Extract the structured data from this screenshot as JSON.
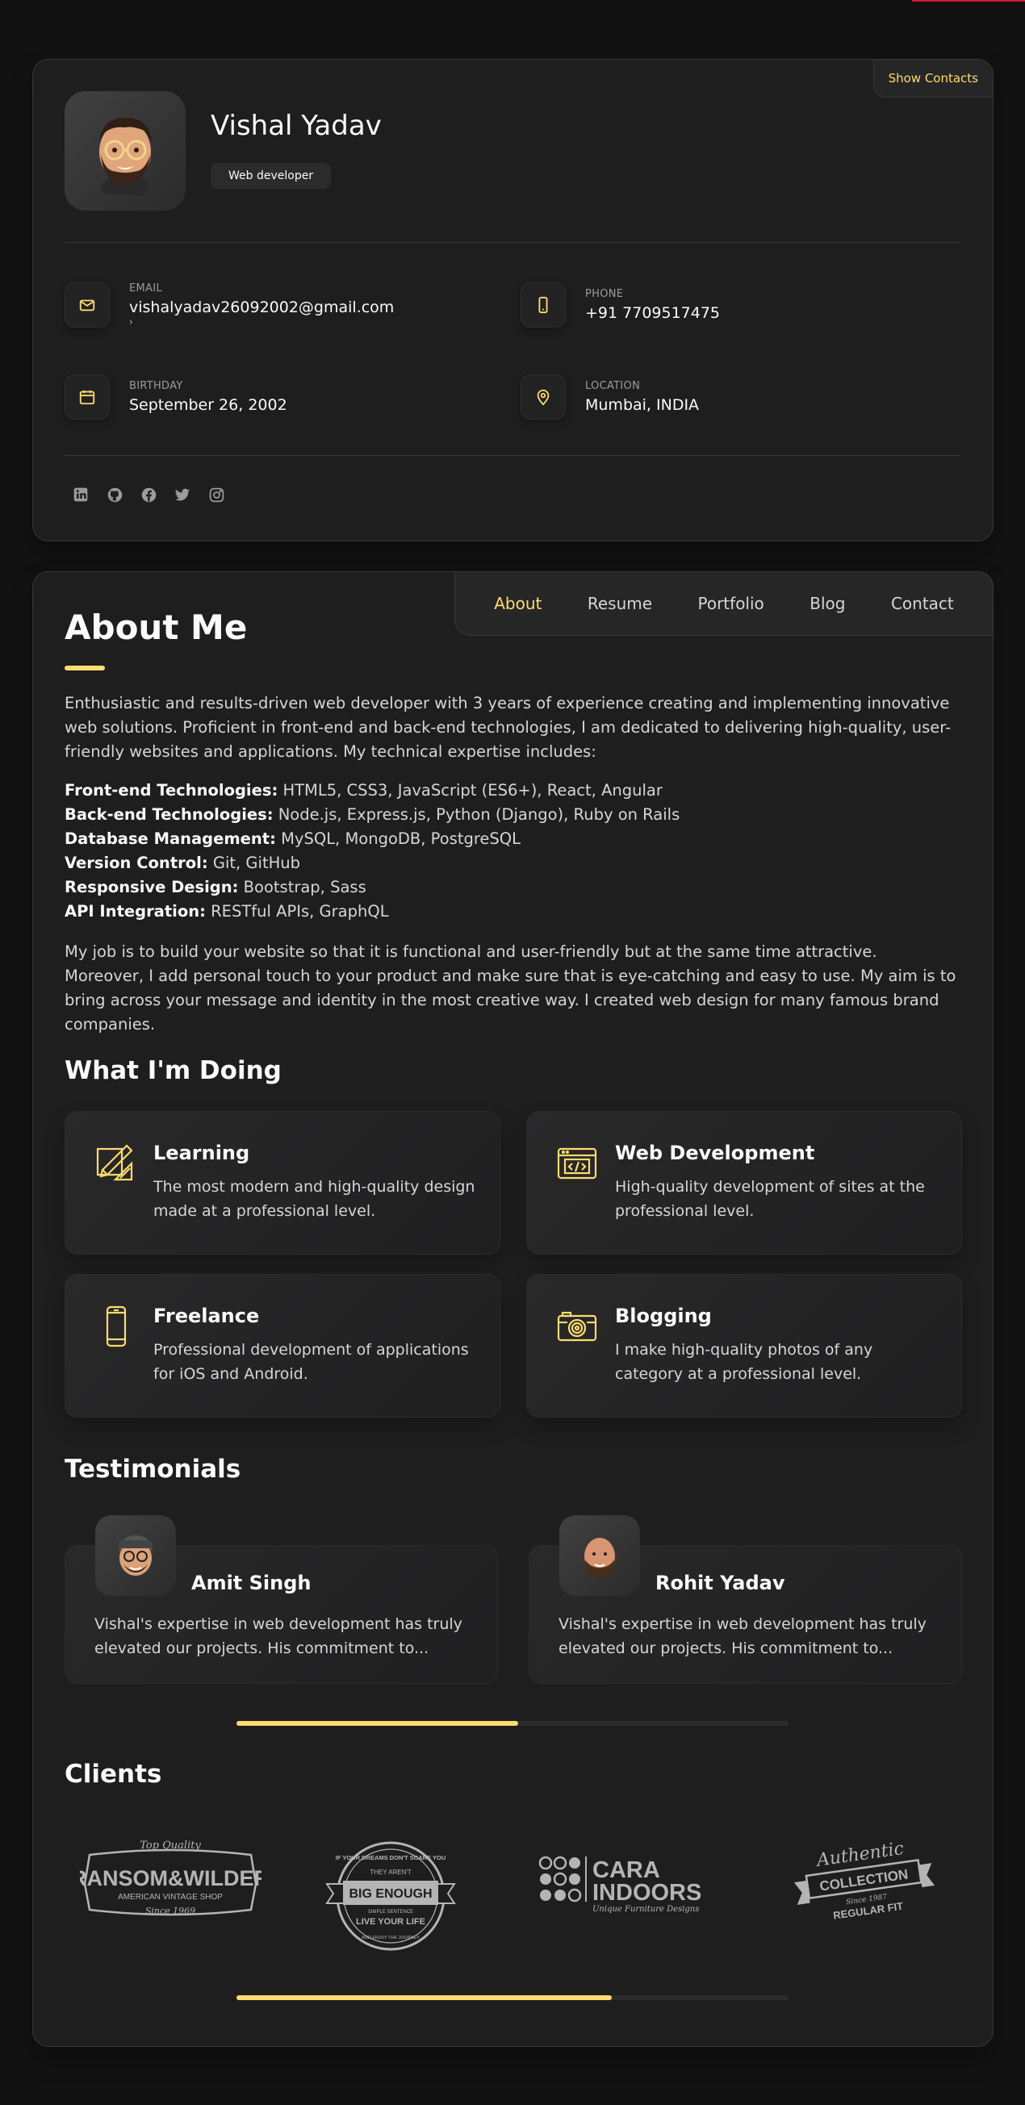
{
  "profile": {
    "name": "Vishal Yadav",
    "title": "Web developer",
    "show_contacts": "Show Contacts"
  },
  "contacts": {
    "email_label": "EMAIL",
    "email": "vishalyadav26092002@gmail.com",
    "phone_label": "PHONE",
    "phone": "+91 7709517475",
    "birthday_label": "BIRTHDAY",
    "birthday": "September 26, 2002",
    "location_label": "LOCATION",
    "location": "Mumbai, INDIA"
  },
  "socials": [
    "linkedin-icon",
    "github-icon",
    "facebook-icon",
    "twitter-icon",
    "instagram-icon"
  ],
  "nav": {
    "about": "About",
    "resume": "Resume",
    "portfolio": "Portfolio",
    "blog": "Blog",
    "contact": "Contact",
    "active": "About"
  },
  "about": {
    "heading": "About Me",
    "intro": "Enthusiastic and results-driven web developer with 3 years of experience creating and implementing innovative web solutions. Proficient in front-end and back-end technologies, I am dedicated to delivering high-quality, user-friendly websites and applications. My technical expertise includes:",
    "skills": [
      {
        "label": "Front-end Technologies:",
        "value": " HTML5, CSS3, JavaScript (ES6+), React, Angular"
      },
      {
        "label": "Back-end Technologies:",
        "value": " Node.js, Express.js, Python (Django), Ruby on Rails"
      },
      {
        "label": "Database Management:",
        "value": " MySQL, MongoDB, PostgreSQL"
      },
      {
        "label": "Version Control:",
        "value": " Git, GitHub"
      },
      {
        "label": "Responsive Design:",
        "value": " Bootstrap, Sass"
      },
      {
        "label": "API Integration:",
        "value": " RESTful APIs, GraphQL"
      }
    ],
    "closing": "My job is to build your website so that it is functional and user-friendly but at the same time attractive. Moreover, I add personal touch to your product and make sure that is eye-catching and easy to use. My aim is to bring across your message and identity in the most creative way. I created web design for many famous brand companies."
  },
  "services": {
    "heading": "What I'm Doing",
    "items": [
      {
        "title": "Learning",
        "desc": "The most modern and high-quality design made at a professional level.",
        "icon": "design-icon"
      },
      {
        "title": "Web Development",
        "desc": "High-quality development of sites at the professional level.",
        "icon": "code-window-icon"
      },
      {
        "title": "Freelance",
        "desc": "Professional development of applications for iOS and Android.",
        "icon": "smartphone-icon"
      },
      {
        "title": "Blogging",
        "desc": "I make high-quality photos of any category at a professional level.",
        "icon": "camera-icon"
      }
    ]
  },
  "testimonials": {
    "heading": "Testimonials",
    "items": [
      {
        "name": "Amit Singh",
        "text": "Vishal's expertise in web development has truly elevated our projects. His commitment to..."
      },
      {
        "name": "Rohit Yadav",
        "text": "Vishal's expertise in web development has truly elevated our projects. His commitment to..."
      }
    ],
    "scroll_progress": 0.51
  },
  "clients": {
    "heading": "Clients",
    "logos": [
      {
        "top": "Top Quality",
        "main": "RANSOM&WILDER",
        "sub": "AMERICAN VINTAGE SHOP",
        "since": "Since 1969"
      },
      {
        "arc_top": "IF YOUR DREAMS DON'T SCARE YOU",
        "they": "THEY AREN'T",
        "main": "BIG ENOUGH",
        "small": "SIMPLE SENTENCE",
        "live": "LIVE YOUR LIFE",
        "bottom": "AND ENJOY THE JOURNEY"
      },
      {
        "main1": "CARA",
        "main2": "INDOORS",
        "sub": "Unique Furniture Designs"
      },
      {
        "top": "Authentic",
        "main": "COLLECTION",
        "since": "Since 1987",
        "sub": "REGULAR FIT"
      }
    ],
    "scroll_progress": 0.68
  },
  "colors": {
    "accent": "#ffdb70",
    "background": "#121212",
    "card": "#1e1e1f"
  }
}
